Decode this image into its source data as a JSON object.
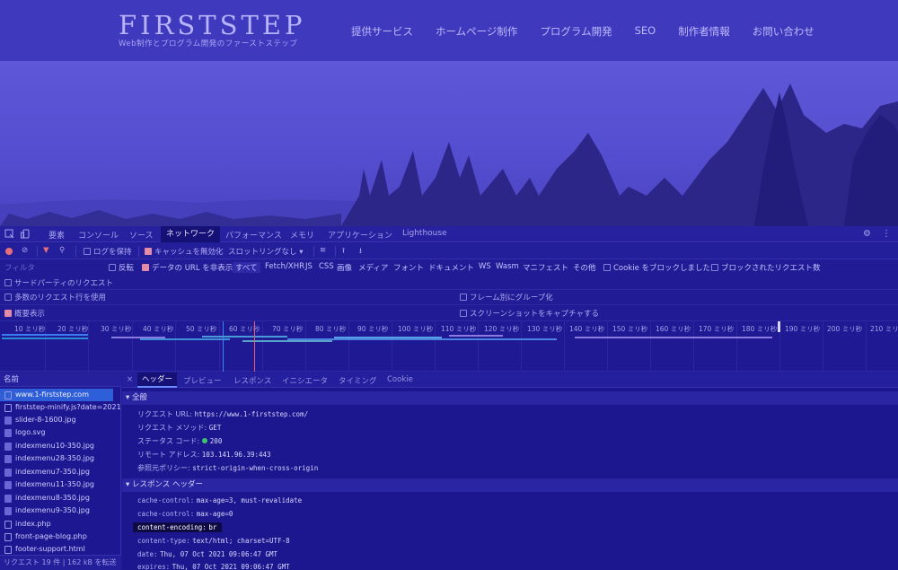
{
  "site": {
    "logo": "FIRSTSTEP",
    "tagline": "Web制作とプログラム開発のファーストステップ",
    "nav": [
      "提供サービス",
      "ホームページ制作",
      "プログラム開発",
      "SEO",
      "制作者情報",
      "お問い合わせ"
    ]
  },
  "devtools": {
    "tabs": [
      "要素",
      "コンソール",
      "ソース",
      "ネットワーク",
      "パフォーマンス",
      "メモリ",
      "アプリケーション",
      "Lighthouse"
    ],
    "active_tab": "ネットワーク",
    "toolbar": {
      "preserve_log": "ログを保持",
      "disable_cache": "キャッシュを無効化",
      "throttling": "スロットリングなし"
    },
    "filter": {
      "placeholder": "フィルタ",
      "invert": "反転",
      "hide_data_urls": "データの URL を非表示",
      "types": [
        "すべて",
        "Fetch/XHR",
        "JS",
        "CSS",
        "画像",
        "メディア",
        "フォント",
        "ドキュメント",
        "WS",
        "Wasm",
        "マニフェスト",
        "その他"
      ],
      "blocked_cookies": "Cookie をブロックしました",
      "blocked_requests": "ブロックされたリクエスト数",
      "third_party": "サードパーティのリクエスト"
    },
    "options": {
      "big_rows": "多数のリクエスト行を使用",
      "group_by_frame": "フレーム別にグループ化",
      "overview": "概要表示",
      "screenshots": "スクリーンショットをキャプチャする"
    },
    "timeline_ticks": [
      "10 ミリ秒",
      "20 ミリ秒",
      "30 ミリ秒",
      "40 ミリ秒",
      "50 ミリ秒",
      "60 ミリ秒",
      "70 ミリ秒",
      "80 ミリ秒",
      "90 ミリ秒",
      "100 ミリ秒",
      "110 ミリ秒",
      "120 ミリ秒",
      "130 ミリ秒",
      "140 ミリ秒",
      "150 ミリ秒",
      "160 ミリ秒",
      "170 ミリ秒",
      "180 ミリ秒",
      "190 ミリ秒",
      "200 ミリ秒",
      "210 ミリ秒"
    ],
    "requests_header": "名前",
    "requests": [
      {
        "name": "www.1-firststep.com",
        "type": "doc"
      },
      {
        "name": "firststep-minify.js?date=2021...",
        "type": "doc"
      },
      {
        "name": "slider-8-1600.jpg",
        "type": "img"
      },
      {
        "name": "logo.svg",
        "type": "img"
      },
      {
        "name": "indexmenu10-350.jpg",
        "type": "img"
      },
      {
        "name": "indexmenu28-350.jpg",
        "type": "img"
      },
      {
        "name": "indexmenu7-350.jpg",
        "type": "img"
      },
      {
        "name": "indexmenu11-350.jpg",
        "type": "img"
      },
      {
        "name": "indexmenu8-350.jpg",
        "type": "img"
      },
      {
        "name": "indexmenu9-350.jpg",
        "type": "img"
      },
      {
        "name": "index.php",
        "type": "doc"
      },
      {
        "name": "front-page-blog.php",
        "type": "doc"
      },
      {
        "name": "footer-support.html",
        "type": "doc"
      }
    ],
    "status": "リクエスト 19 件 | 162 kB を転送",
    "detail_tabs": [
      "ヘッダー",
      "プレビュー",
      "レスポンス",
      "イニシエータ",
      "タイミング",
      "Cookie"
    ],
    "general": {
      "title": "▾ 全般",
      "rows": [
        {
          "k": "リクエスト URL:",
          "v": "https://www.1-firststep.com/"
        },
        {
          "k": "リクエスト メソッド:",
          "v": "GET"
        },
        {
          "k": "ステータス コード:",
          "v": "200"
        },
        {
          "k": "リモート アドレス:",
          "v": "103.141.96.39:443"
        },
        {
          "k": "参照元ポリシー:",
          "v": "strict-origin-when-cross-origin"
        }
      ]
    },
    "response_headers": {
      "title": "▾ レスポンス ヘッダー",
      "rows": [
        {
          "k": "cache-control:",
          "v": "max-age=3, must-revalidate"
        },
        {
          "k": "cache-control:",
          "v": "max-age=0"
        },
        {
          "k": "content-encoding:",
          "v": "br"
        },
        {
          "k": "content-type:",
          "v": "text/html; charset=UTF-8"
        },
        {
          "k": "date:",
          "v": "Thu, 07 Oct 2021 09:06:47 GMT"
        },
        {
          "k": "expires:",
          "v": "Thu, 07 Oct 2021 09:06:47 GMT"
        }
      ]
    }
  }
}
